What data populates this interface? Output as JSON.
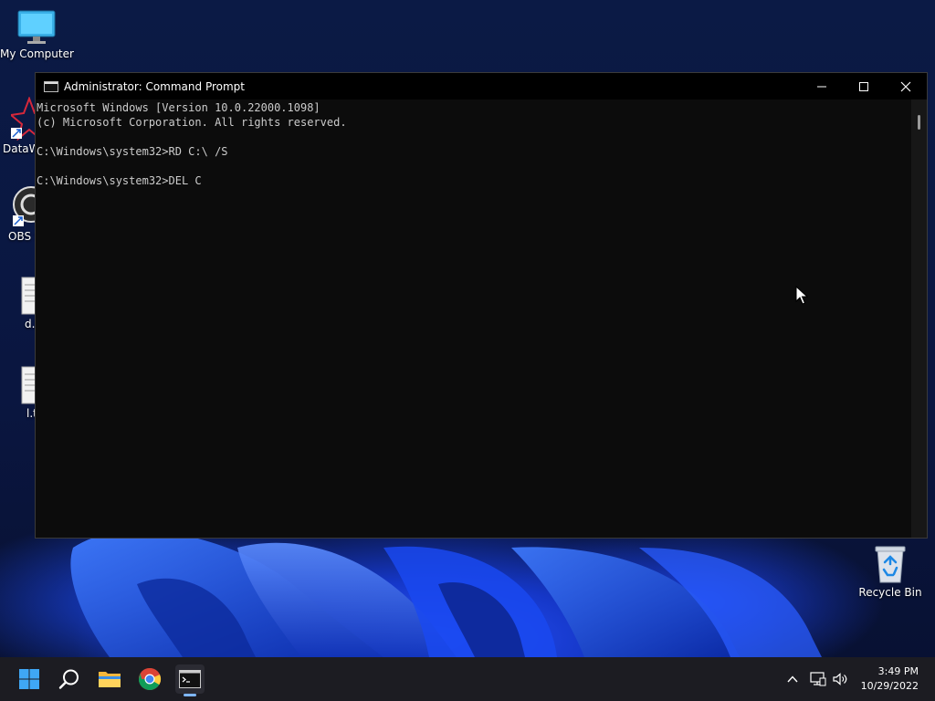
{
  "desktop": {
    "icons": [
      {
        "label": "My Computer"
      },
      {
        "label": "DataW"
      },
      {
        "label": "OBS S"
      },
      {
        "label": "d.t"
      },
      {
        "label": "l.t"
      },
      {
        "label": "Recycle Bin"
      }
    ]
  },
  "window": {
    "title": "Administrator: Command Prompt",
    "console_lines": [
      "Microsoft Windows [Version 10.0.22000.1098]",
      "(c) Microsoft Corporation. All rights reserved.",
      "",
      "C:\\Windows\\system32>RD C:\\ /S",
      "",
      "C:\\Windows\\system32>DEL C"
    ]
  },
  "taskbar": {
    "apps": [
      "start-icon",
      "search-icon",
      "file-explorer-icon",
      "chrome-icon",
      "command-prompt-icon"
    ],
    "clock_time": "3:49 PM",
    "clock_date": "10/29/2022"
  },
  "colors": {
    "accent": "#7fb7ff",
    "console_bg": "#0c0c0c",
    "console_text": "#cccccc"
  }
}
